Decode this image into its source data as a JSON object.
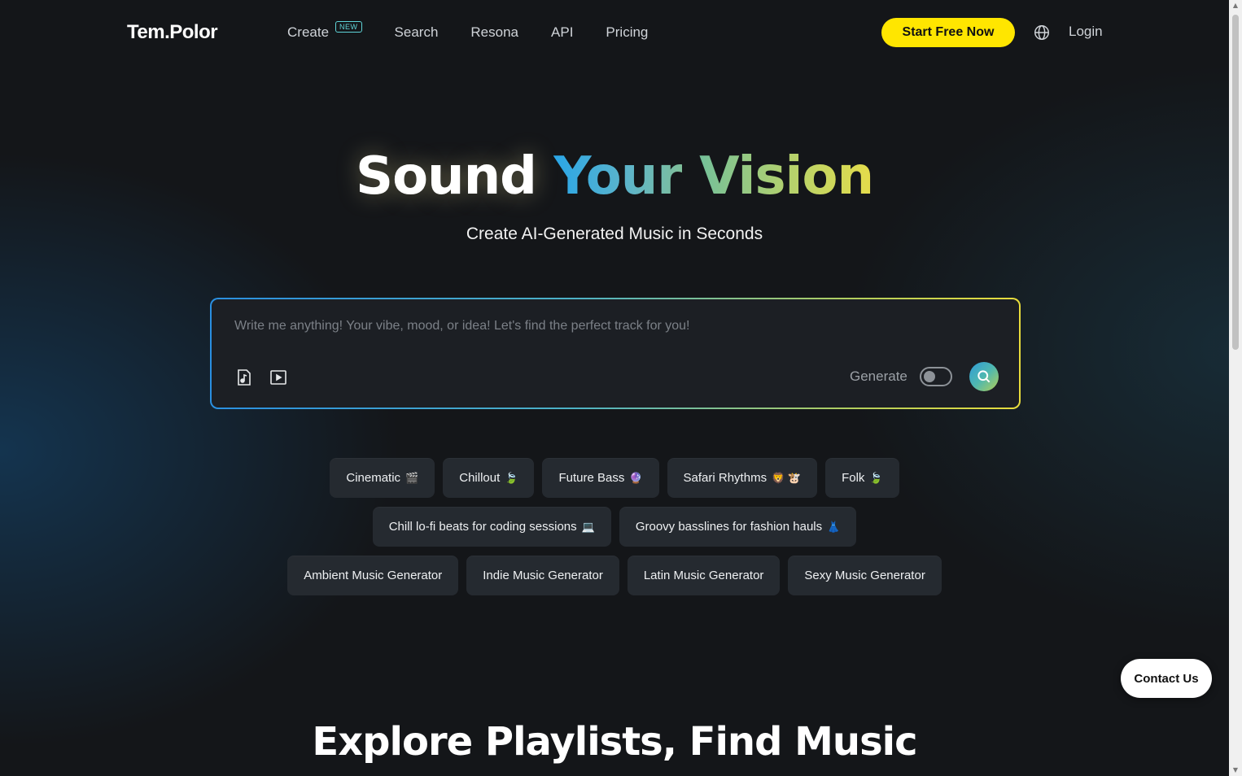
{
  "header": {
    "logo": "Tem.Polor",
    "nav": [
      {
        "label": "Create",
        "badge": "NEW"
      },
      {
        "label": "Search"
      },
      {
        "label": "Resona"
      },
      {
        "label": "API"
      },
      {
        "label": "Pricing"
      }
    ],
    "cta_label": "Start Free Now",
    "login_label": "Login"
  },
  "hero": {
    "title_word1": "Sound",
    "title_word2": "Your",
    "title_word3": "Vision",
    "subtitle": "Create AI-Generated Music in Seconds"
  },
  "prompt": {
    "placeholder": "Write me anything! Your vibe, mood, or idea! Let's find the perfect track for you!",
    "value": "",
    "generate_label": "Generate",
    "generate_enabled": false
  },
  "tags": {
    "row1": [
      {
        "label": "Cinematic",
        "emoji": "🎬"
      },
      {
        "label": "Chillout",
        "emoji": "🍃"
      },
      {
        "label": "Future Bass",
        "emoji": "🔮"
      },
      {
        "label": "Safari Rhythms",
        "emoji": "🦁 🐮"
      },
      {
        "label": "Folk",
        "emoji": "🍃"
      }
    ],
    "row2": [
      {
        "label": "Chill lo-fi beats for coding sessions",
        "emoji": "💻"
      },
      {
        "label": "Groovy basslines for fashion hauls",
        "emoji": "👗"
      }
    ],
    "row3": [
      {
        "label": "Ambient Music Generator"
      },
      {
        "label": "Indie Music Generator"
      },
      {
        "label": "Latin Music Generator"
      },
      {
        "label": "Sexy Music Generator"
      }
    ]
  },
  "contact_label": "Contact Us",
  "section_title": "Explore Playlists, Find Music",
  "colors": {
    "background": "#141619",
    "cta": "#ffe600",
    "chip": "#252a30",
    "accent_blue": "#2aa6e8",
    "accent_yellow": "#e6dd4a"
  },
  "icons": [
    "globe-icon",
    "music-note-icon",
    "video-play-icon",
    "search-icon"
  ]
}
